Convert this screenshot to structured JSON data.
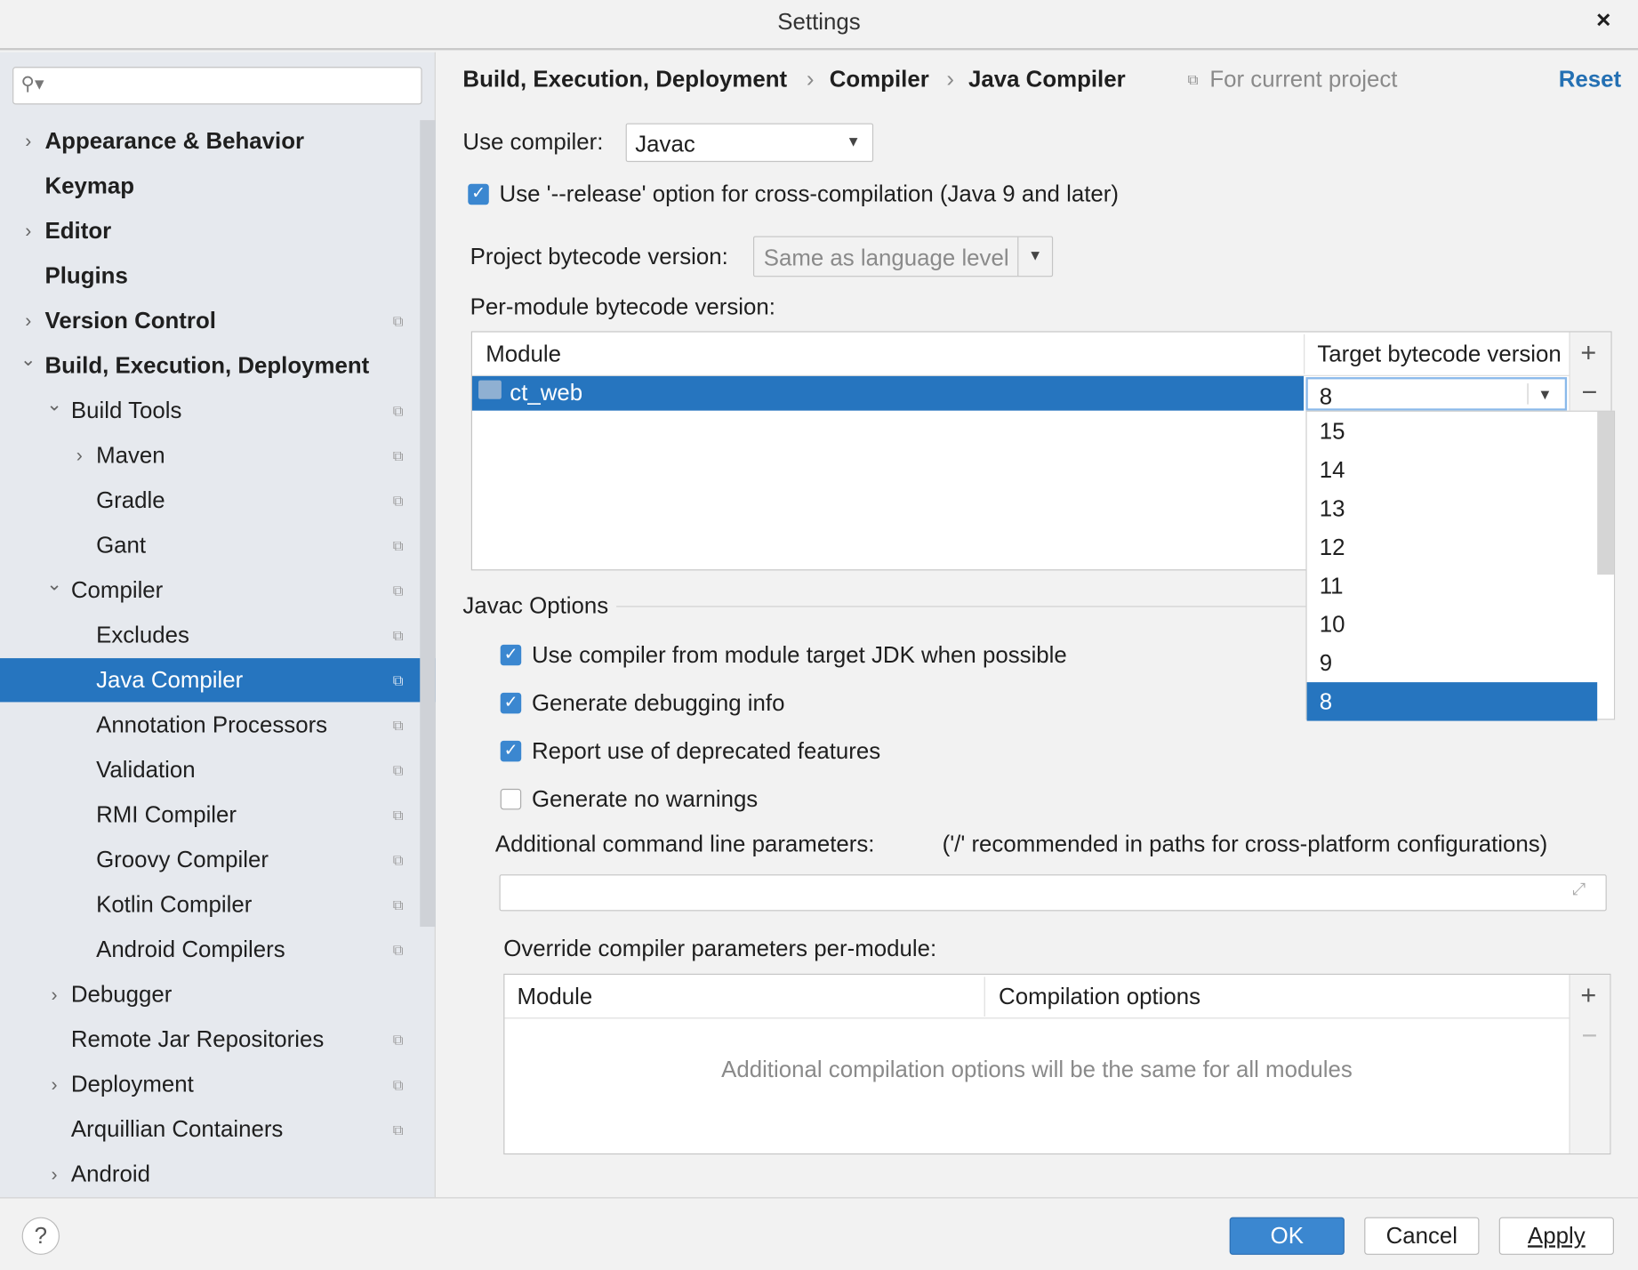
{
  "window": {
    "title": "Settings",
    "close": "×"
  },
  "sidebar": {
    "search_placeholder": "",
    "items": [
      {
        "label": "Appearance & Behavior",
        "level": 0,
        "arrow": "right",
        "bold": true,
        "shared": false
      },
      {
        "label": "Keymap",
        "level": 0,
        "arrow": "",
        "bold": true,
        "shared": false
      },
      {
        "label": "Editor",
        "level": 0,
        "arrow": "right",
        "bold": true,
        "shared": false
      },
      {
        "label": "Plugins",
        "level": 0,
        "arrow": "",
        "bold": true,
        "shared": false
      },
      {
        "label": "Version Control",
        "level": 0,
        "arrow": "right",
        "bold": true,
        "shared": true
      },
      {
        "label": "Build, Execution, Deployment",
        "level": 0,
        "arrow": "down",
        "bold": true,
        "shared": false
      },
      {
        "label": "Build Tools",
        "level": 1,
        "arrow": "down",
        "shared": true
      },
      {
        "label": "Maven",
        "level": 2,
        "arrow": "right",
        "shared": true
      },
      {
        "label": "Gradle",
        "level": 2,
        "arrow": "",
        "shared": true
      },
      {
        "label": "Gant",
        "level": 2,
        "arrow": "",
        "shared": true
      },
      {
        "label": "Compiler",
        "level": 1,
        "arrow": "down",
        "shared": true
      },
      {
        "label": "Excludes",
        "level": 2,
        "arrow": "",
        "shared": true
      },
      {
        "label": "Java Compiler",
        "level": 2,
        "arrow": "",
        "shared": true,
        "selected": true
      },
      {
        "label": "Annotation Processors",
        "level": 2,
        "arrow": "",
        "shared": true
      },
      {
        "label": "Validation",
        "level": 2,
        "arrow": "",
        "shared": true
      },
      {
        "label": "RMI Compiler",
        "level": 2,
        "arrow": "",
        "shared": true
      },
      {
        "label": "Groovy Compiler",
        "level": 2,
        "arrow": "",
        "shared": true
      },
      {
        "label": "Kotlin Compiler",
        "level": 2,
        "arrow": "",
        "shared": true
      },
      {
        "label": "Android Compilers",
        "level": 2,
        "arrow": "",
        "shared": true
      },
      {
        "label": "Debugger",
        "level": 1,
        "arrow": "right",
        "shared": false
      },
      {
        "label": "Remote Jar Repositories",
        "level": 1,
        "arrow": "",
        "shared": true
      },
      {
        "label": "Deployment",
        "level": 1,
        "arrow": "right",
        "shared": true
      },
      {
        "label": "Arquillian Containers",
        "level": 1,
        "arrow": "",
        "shared": true
      },
      {
        "label": "Android",
        "level": 1,
        "arrow": "right",
        "shared": false
      }
    ]
  },
  "breadcrumb": {
    "items": [
      "Build, Execution, Deployment",
      "Compiler",
      "Java Compiler"
    ],
    "separator": "›",
    "scope": "For current project",
    "reset": "Reset"
  },
  "compiler": {
    "label": "Use compiler:",
    "value": "Javac"
  },
  "release_option": {
    "label": "Use '--release' option for cross-compilation (Java 9 and later)",
    "checked": true
  },
  "project_bytecode": {
    "label": "Project bytecode version:",
    "value": "Same as language level"
  },
  "per_module": {
    "label": "Per-module bytecode version:",
    "columns": [
      "Module",
      "Target bytecode version"
    ],
    "rows": [
      {
        "module": "ct_web",
        "target": "8"
      }
    ],
    "dropdown_options": [
      "15",
      "14",
      "13",
      "12",
      "11",
      "10",
      "9",
      "8"
    ],
    "dropdown_selected": "8"
  },
  "javac": {
    "section": "Javac Options",
    "options": [
      {
        "label": "Use compiler from module target JDK when possible",
        "checked": true
      },
      {
        "label": "Generate debugging info",
        "checked": true
      },
      {
        "label": "Report use of deprecated features",
        "checked": true
      },
      {
        "label": "Generate no warnings",
        "checked": false
      }
    ],
    "cmdline_label": "Additional command line parameters:",
    "cmdline_hint": "('/' recommended in paths for cross-platform configurations)",
    "cmdline_value": "",
    "override_label": "Override compiler parameters per-module:",
    "override_columns": [
      "Module",
      "Compilation options"
    ],
    "override_empty": "Additional compilation options will be the same for all modules"
  },
  "footer": {
    "help": "?",
    "ok": "OK",
    "cancel": "Cancel",
    "apply": "Apply"
  },
  "colors": {
    "accent": "#2675bf",
    "link": "#2470b3"
  }
}
